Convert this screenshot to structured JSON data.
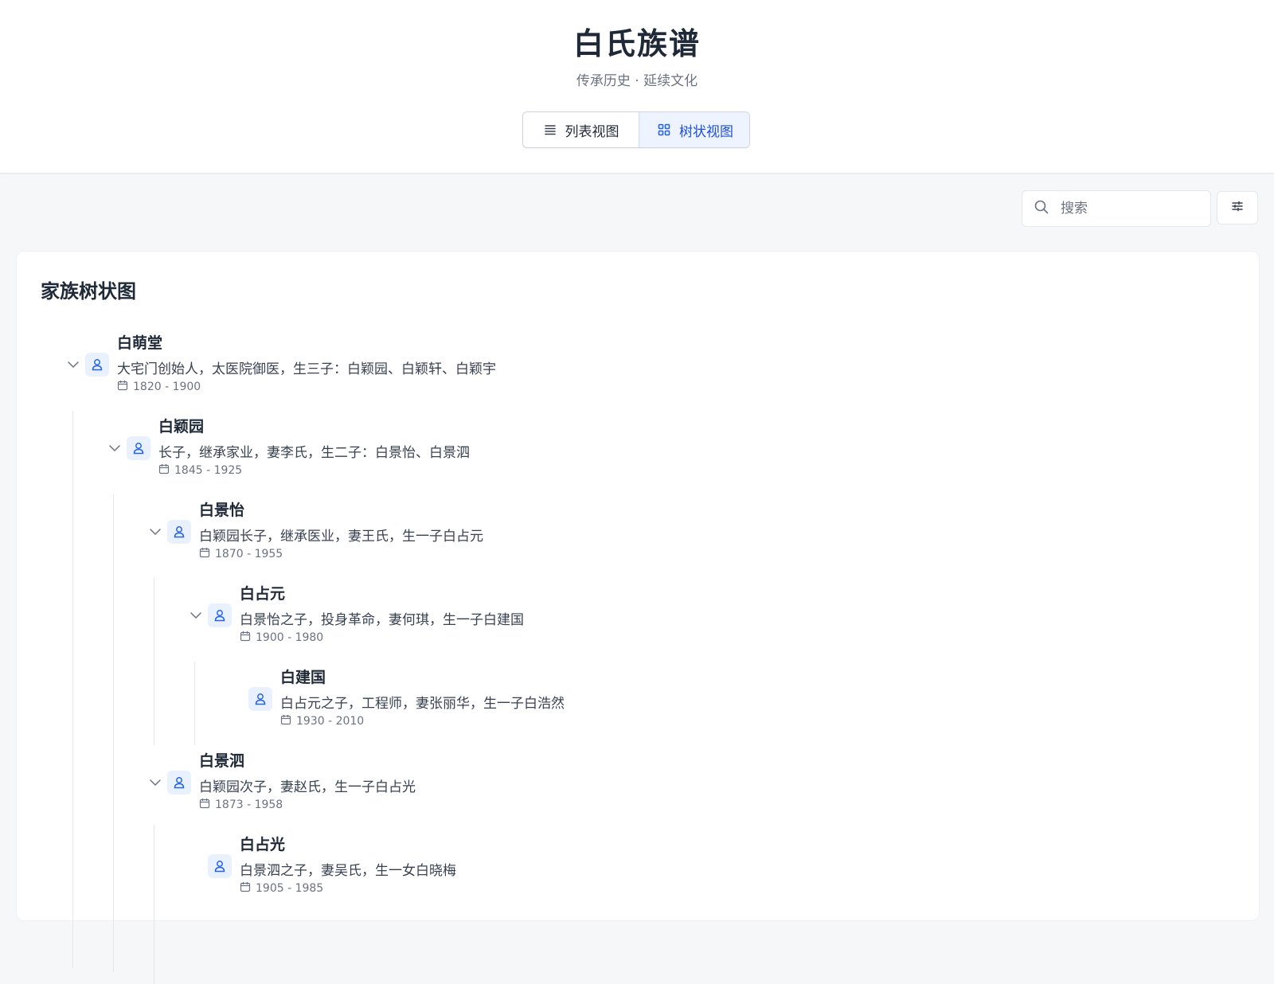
{
  "header": {
    "title": "白氏族谱",
    "subtitle": "传承历史 · 延续文化"
  },
  "view_toggle": {
    "list_label": "列表视图",
    "tree_label": "树状视图",
    "active": "tree"
  },
  "search": {
    "placeholder": "搜索",
    "value": ""
  },
  "card": {
    "title": "家族树状图"
  },
  "tree": [
    {
      "name": "白萌堂",
      "desc": "大宅门创始人，太医院御医，生三子：白颖园、白颖轩、白颖宇",
      "years": "1820 - 1900",
      "expanded": true
    },
    {
      "name": "白颖园",
      "desc": "长子，继承家业，妻李氏，生二子：白景怡、白景泗",
      "years": "1845 - 1925",
      "expanded": true
    },
    {
      "name": "白景怡",
      "desc": "白颖园长子，继承医业，妻王氏，生一子白占元",
      "years": "1870 - 1955",
      "expanded": true
    },
    {
      "name": "白占元",
      "desc": "白景怡之子，投身革命，妻何琪，生一子白建国",
      "years": "1900 - 1980",
      "expanded": true
    },
    {
      "name": "白建国",
      "desc": "白占元之子，工程师，妻张丽华，生一子白浩然",
      "years": "1930 - 2010",
      "expanded": false
    },
    {
      "name": "白景泗",
      "desc": "白颖园次子，妻赵氏，生一子白占光",
      "years": "1873 - 1958",
      "expanded": true
    },
    {
      "name": "白占光",
      "desc": "白景泗之子，妻吴氏，生一女白晓梅",
      "years": "1905 - 1985",
      "expanded": false
    }
  ],
  "colors": {
    "accent": "#2563eb",
    "avatar_bg": "#eaf1fe"
  }
}
